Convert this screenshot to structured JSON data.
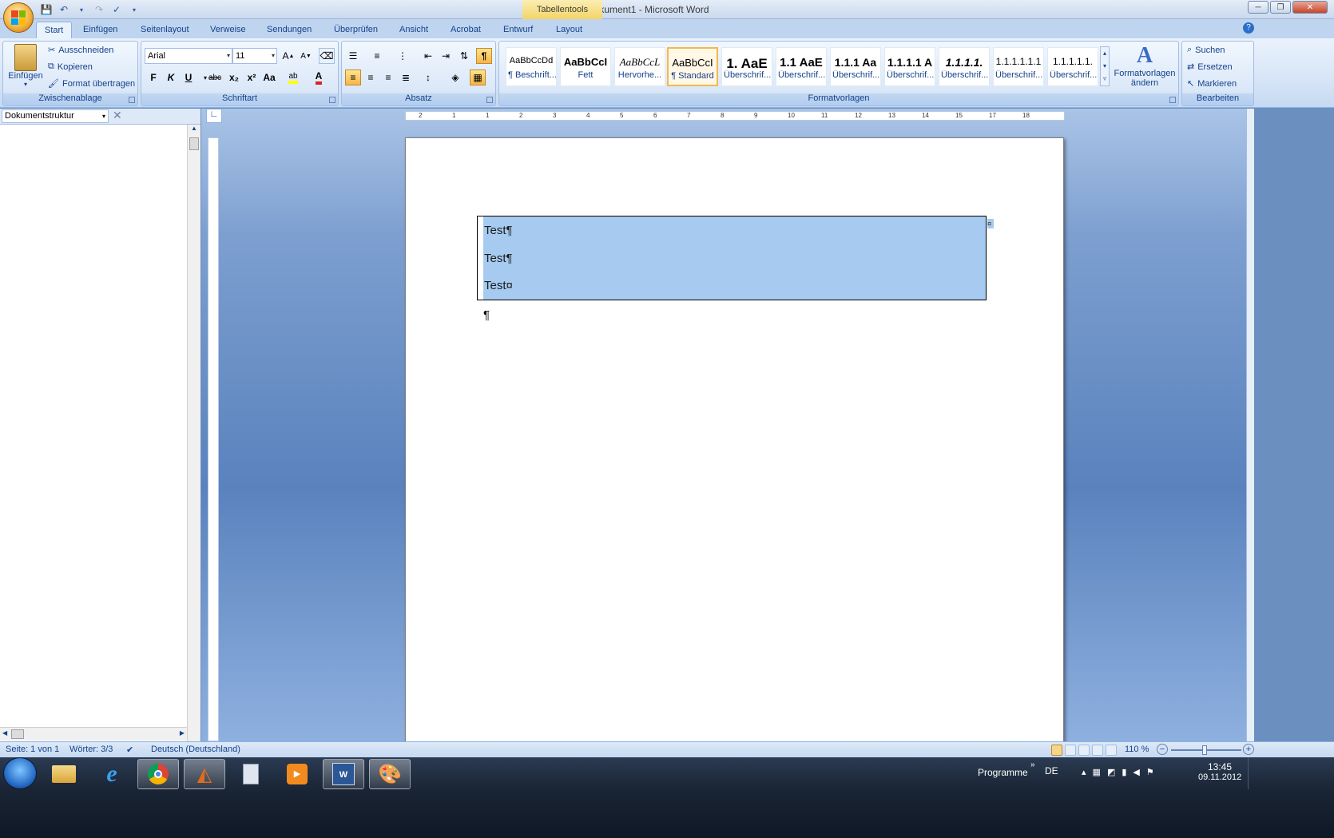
{
  "window": {
    "title": "Dokument1 - Microsoft Word",
    "context_tab_title": "Tabellentools"
  },
  "tabs": [
    "Start",
    "Einfügen",
    "Seitenlayout",
    "Verweise",
    "Sendungen",
    "Überprüfen",
    "Ansicht",
    "Acrobat",
    "Entwurf",
    "Layout"
  ],
  "ribbon": {
    "clipboard": {
      "label": "Zwischenablage",
      "paste": "Einfügen",
      "cut": "Ausschneiden",
      "copy": "Kopieren",
      "format_painter": "Format übertragen"
    },
    "font": {
      "label": "Schriftart",
      "font_name": "Arial",
      "font_size": "11",
      "bold": "F",
      "italic": "K",
      "underline": "U",
      "strike": "abc",
      "subscript": "x₂",
      "superscript": "x²",
      "case": "Aa"
    },
    "paragraph": {
      "label": "Absatz"
    },
    "styles": {
      "label": "Formatvorlagen",
      "items": [
        {
          "sample": "AaBbCcDd",
          "name": "¶ Beschrift..."
        },
        {
          "sample": "AaBbCcI",
          "name": "Fett"
        },
        {
          "sample": "AaBbCcL",
          "name": "Hervorhe..."
        },
        {
          "sample": "AaBbCcI",
          "name": "¶ Standard"
        },
        {
          "sample": "1. AaE",
          "name": "Überschrif..."
        },
        {
          "sample": "1.1 AaE",
          "name": "Überschrif..."
        },
        {
          "sample": "1.1.1 Aa",
          "name": "Überschrif..."
        },
        {
          "sample": "1.1.1.1 A",
          "name": "Überschrif..."
        },
        {
          "sample": "1.1.1.1.",
          "name": "Überschrif..."
        },
        {
          "sample": "1.1.1.1.1.1",
          "name": "Überschrif..."
        },
        {
          "sample": "1.1.1.1.1.",
          "name": "Überschrif..."
        }
      ],
      "change_styles": "Formatvorlagen ändern"
    },
    "editing": {
      "label": "Bearbeiten",
      "find": "Suchen",
      "replace": "Ersetzen",
      "select": "Markieren"
    }
  },
  "nav_pane": {
    "mode": "Dokumentstruktur"
  },
  "document": {
    "table_lines": [
      "Test¶",
      "Test¶",
      "Test¤"
    ],
    "end_of_row_mark": "¤",
    "after_table": "¶"
  },
  "ruler_numbers": [
    "2",
    "1",
    "1",
    "2",
    "3",
    "4",
    "5",
    "6",
    "7",
    "8",
    "9",
    "10",
    "11",
    "12",
    "13",
    "14",
    "15",
    "17",
    "18"
  ],
  "status": {
    "page": "Seite: 1 von 1",
    "words": "Wörter: 3/3",
    "language": "Deutsch (Deutschland)",
    "zoom": "110 %"
  },
  "taskbar": {
    "programs_label": "Programme",
    "lang": "DE",
    "time": "13:45",
    "date": "09.11.2012"
  },
  "colors": {
    "selection": "#a6caf0",
    "ribbon_accent": "#15428b",
    "active_style_border": "#f3b850"
  }
}
